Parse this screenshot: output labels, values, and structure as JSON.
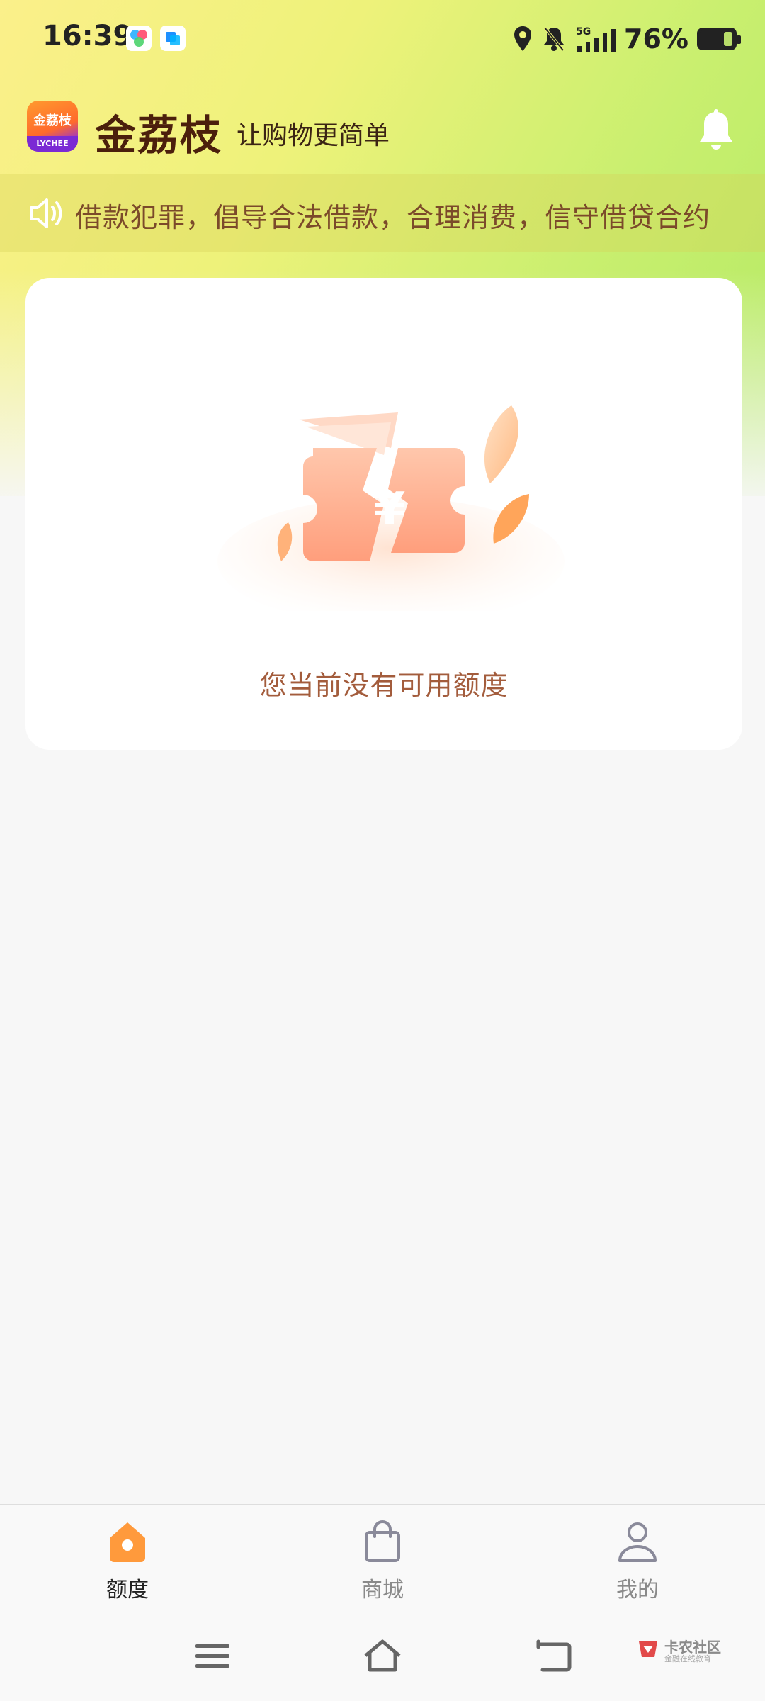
{
  "status_bar": {
    "time": "16:39",
    "network": "5G",
    "battery_percent": "76%",
    "icons": [
      "location-icon",
      "bell-muted-icon",
      "signal-icon",
      "battery-icon"
    ]
  },
  "header": {
    "logo_text": "金荔枝",
    "logo_sub": "LYCHEE",
    "app_name": "金荔枝",
    "slogan": "让购物更简单"
  },
  "notice": {
    "text": "借款犯罪，倡导合法借款，合理消费，信守借贷合约"
  },
  "card": {
    "empty_message": "您当前没有可用额度"
  },
  "tabs": [
    {
      "label": "额度",
      "active": true,
      "icon": "home-icon"
    },
    {
      "label": "商城",
      "active": false,
      "icon": "shopping-bag-icon"
    },
    {
      "label": "我的",
      "active": false,
      "icon": "profile-icon"
    }
  ],
  "watermark": {
    "title": "卡农社区",
    "subtitle": "金融在线教育"
  },
  "colors": {
    "accent": "#ff9a3c",
    "brand_text": "#4b1f0c",
    "empty_text": "#a35c3c"
  }
}
